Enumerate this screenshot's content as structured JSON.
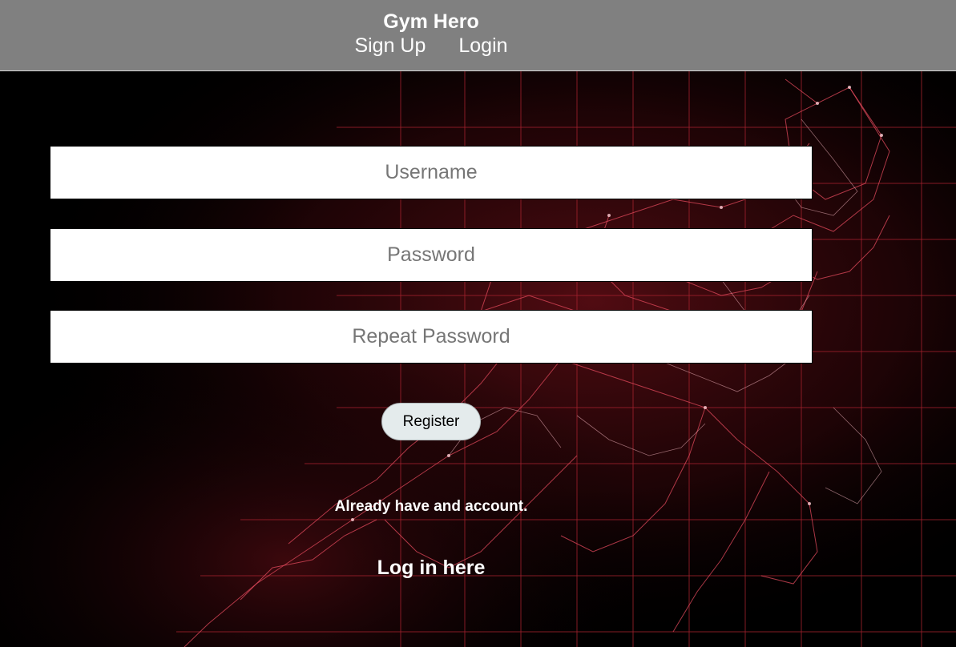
{
  "app": {
    "title": "Gym Hero"
  },
  "nav": {
    "items": [
      {
        "label": "Sign Up"
      },
      {
        "label": "Login"
      }
    ]
  },
  "form": {
    "username": {
      "value": "",
      "placeholder": "Username"
    },
    "password": {
      "value": "",
      "placeholder": "Password"
    },
    "repeat_password": {
      "value": "",
      "placeholder": "Repeat Password"
    },
    "register_label": "Register"
  },
  "footer": {
    "already_text": "Already have and account.",
    "login_link_label": "Log in here"
  },
  "colors": {
    "header_bg": "#808080",
    "page_bg": "#000000",
    "accent_red": "#c0283a",
    "button_bg": "#e4ebec"
  },
  "background": {
    "description_icon": "red-wireframe-runner-image"
  }
}
